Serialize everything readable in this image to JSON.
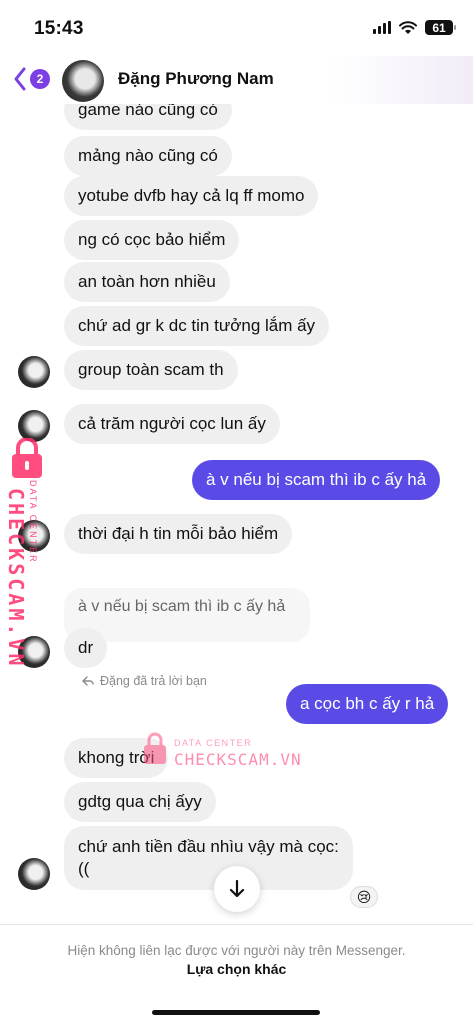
{
  "status": {
    "time": "15:43",
    "battery": "61"
  },
  "header": {
    "back_count": "2",
    "contact_name": "Đặng Phương Nam"
  },
  "messages": [
    {
      "text": "game nào cũng có"
    },
    {
      "text": "mảng nào cũng có"
    },
    {
      "text": "yotube dvfb hay cả lq ff momo"
    },
    {
      "text": "ng có cọc bảo hiểm"
    },
    {
      "text": "an toàn hơn nhiều"
    },
    {
      "text": "chứ ad gr k dc tin tưởng lắm ấy"
    },
    {
      "text": "group toàn scam th"
    },
    {
      "text": "cả trăm người cọc lun ấy"
    },
    {
      "text": "à v nếu bị scam thì ib c ấy hả"
    },
    {
      "text": "thời đại h tin mỗi bảo hiểm"
    },
    {
      "text": "dr"
    },
    {
      "text": "a cọc bh c ấy r hả"
    },
    {
      "text": "khong trời"
    },
    {
      "text": "gdtg qua chị ấyy"
    },
    {
      "text": "chứ anh tiền đầu nhìu vậy mà cọc:"
    },
    {
      "text": "(("
    }
  ],
  "reply": {
    "label": "Đặng đã trả lời bạn",
    "quote": "à v nếu bị scam thì ib c ấy hả"
  },
  "reaction": {
    "emoji": "😢"
  },
  "watermark": {
    "vertical_sub": "DATA CENTER",
    "vertical_main": "CHECKSCAM.VN",
    "center_sub": "DATA CENTER",
    "center_main": "CHECKSCAM.VN"
  },
  "footer": {
    "note": "Hiện không liên lạc được với người này trên Messenger.",
    "action": "Lựa chọn khác"
  },
  "colors": {
    "outgoing": "#5b4be6",
    "incoming": "#efefef",
    "accent": "#7b3fe4",
    "watermark": "#ff2f6a"
  }
}
